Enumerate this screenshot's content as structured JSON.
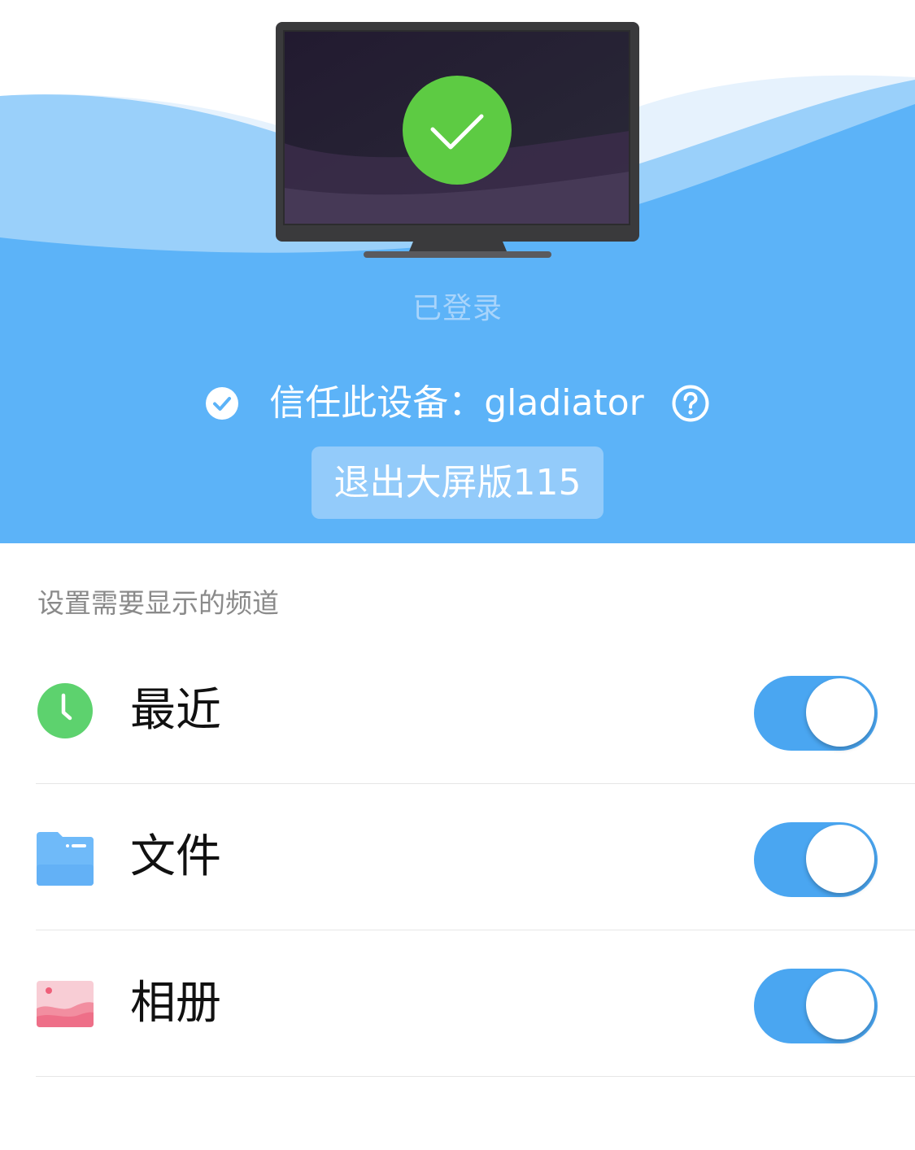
{
  "header": {
    "status": "已登录",
    "trust_label": "信任此设备：gladiator",
    "exit_button_label": "退出大屏版115"
  },
  "channels": {
    "section_title": "设置需要显示的频道",
    "items": [
      {
        "label": "最近",
        "icon": "clock-icon",
        "enabled": true
      },
      {
        "label": "文件",
        "icon": "folder-icon",
        "enabled": true
      },
      {
        "label": "相册",
        "icon": "album-icon",
        "enabled": true
      }
    ]
  },
  "colors": {
    "hero_blue": "#5cb3f8",
    "toggle_on": "#4aa6f1",
    "success_green": "#5dcb43"
  }
}
